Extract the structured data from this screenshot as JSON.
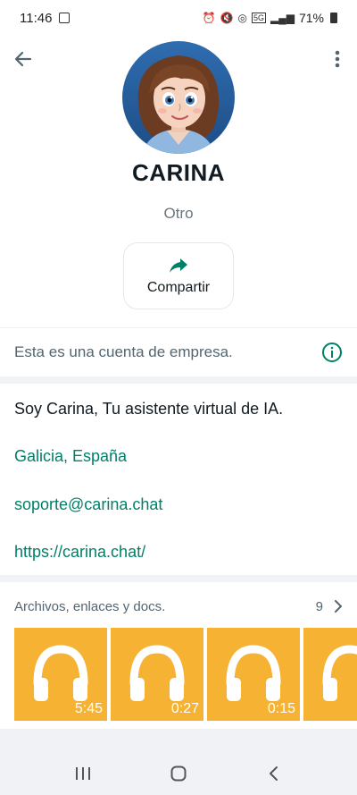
{
  "status_bar": {
    "time": "11:46",
    "battery": "71%",
    "network": "5G"
  },
  "profile": {
    "name": "CARINA",
    "subtitle": "Otro",
    "share_label": "Compartir",
    "avatar_desc": "avatar-illustration"
  },
  "business": {
    "notice": "Esta es una cuenta de empresa."
  },
  "about": {
    "bio": "Soy Carina, Tu asistente virtual de IA.",
    "location": "Galicia, España",
    "email": "soporte@carina.chat",
    "website": "https://carina.chat/"
  },
  "media": {
    "title": "Archivos, enlaces y docs.",
    "count": "9",
    "items": [
      {
        "icon": "headphones-icon",
        "duration": "5:45"
      },
      {
        "icon": "headphones-icon",
        "duration": "0:27"
      },
      {
        "icon": "headphones-icon",
        "duration": "0:15"
      },
      {
        "icon": "headphones-icon",
        "duration": ""
      }
    ]
  },
  "colors": {
    "accent": "#008069",
    "tile": "#f6b233",
    "background": "#f0f2f5"
  }
}
